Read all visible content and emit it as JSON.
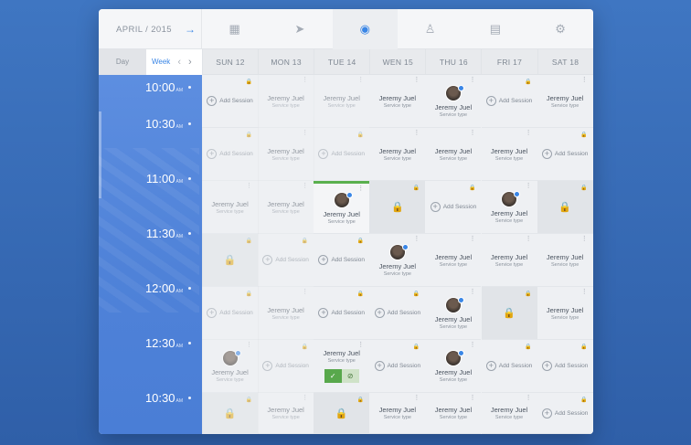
{
  "topbar": {
    "month_label": "APRIL / 2015",
    "month_next_icon": "arrow-right-icon",
    "nav_icons": [
      "calendar-icon",
      "send-icon",
      "fingerprint-icon",
      "user-icon",
      "document-icon",
      "gear-icon"
    ],
    "active_index": 2
  },
  "viewswitch": {
    "day_label": "Day",
    "week_label": "Week",
    "prev_icon": "chevron-left-icon",
    "next_icon": "chevron-right-icon"
  },
  "days": [
    "SUN 12",
    "MON 13",
    "TUE 14",
    "WEN 15",
    "THU 16",
    "FRI 17",
    "SAT 18"
  ],
  "times": [
    "10:00",
    "10:30",
    "11:00",
    "11:30",
    "12:00",
    "12:30",
    "10:30"
  ],
  "ampm": "AM",
  "labels": {
    "name": "Jeremy Juel",
    "service": "Service type",
    "add": "Add Session"
  },
  "colors": {
    "accent": "#3a86e6",
    "confirm": "#58a84c",
    "sidebar": "#4f82d8"
  },
  "grid": [
    [
      "add",
      "booked-faded",
      "booked-faded",
      "booked",
      "booked-avatar",
      "add",
      "booked"
    ],
    [
      "add-faded",
      "booked-faded",
      "add-faded",
      "booked",
      "booked",
      "booked",
      "add"
    ],
    [
      "booked-faded",
      "booked-faded",
      "booked-avatar-selected",
      "locked",
      "add",
      "booked-avatar",
      "locked"
    ],
    [
      "locked-faded",
      "add-faded",
      "add",
      "booked-avatar",
      "booked",
      "booked",
      "booked"
    ],
    [
      "add-faded",
      "booked-faded",
      "add",
      "add",
      "booked-avatar",
      "locked",
      "booked"
    ],
    [
      "booked-avatar-faded",
      "add-faded",
      "booked-actions",
      "add",
      "booked-avatar",
      "add",
      "add"
    ],
    [
      "locked-faded",
      "booked-faded",
      "locked",
      "booked",
      "booked",
      "booked",
      "add"
    ]
  ]
}
